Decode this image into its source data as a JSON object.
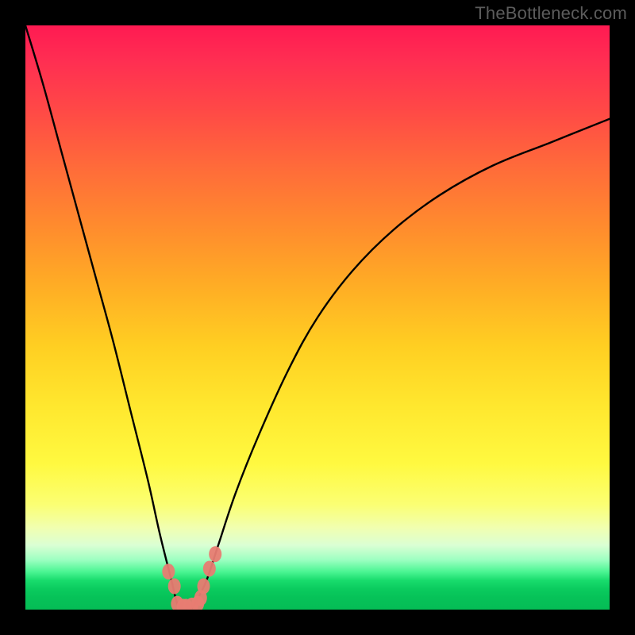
{
  "watermark": "TheBottleneck.com",
  "colors": {
    "frame": "#000000",
    "curve": "#000000",
    "marker": "#e87c72"
  },
  "chart_data": {
    "type": "line",
    "title": "",
    "xlabel": "",
    "ylabel": "",
    "xlim": [
      0,
      100
    ],
    "ylim": [
      0,
      100
    ],
    "grid": false,
    "x_optimum": 27,
    "note": "V-shaped bottleneck curve; value descends sharply to ~0 near x≈27 then rises again. Marker cluster at the trough.",
    "series": [
      {
        "name": "bottleneck-curve",
        "x": [
          0,
          3,
          6,
          9,
          12,
          15,
          18,
          21,
          23,
          25,
          26,
          27,
          28,
          29,
          31,
          33,
          36,
          40,
          45,
          50,
          56,
          63,
          71,
          80,
          90,
          100
        ],
        "values": [
          100,
          90,
          79,
          68,
          57,
          46,
          34,
          22,
          13,
          5,
          1,
          0,
          0,
          1,
          5,
          11,
          20,
          30,
          41,
          50,
          58,
          65,
          71,
          76,
          80,
          84
        ]
      }
    ],
    "markers": {
      "name": "optimum-points",
      "x": [
        24.5,
        25.5,
        26.0,
        27.0,
        27.5,
        28.5,
        29.5,
        30.0,
        30.5,
        31.5,
        32.5
      ],
      "values": [
        6.5,
        4.0,
        1.0,
        0.5,
        0.5,
        0.7,
        1.0,
        2.0,
        4.0,
        7.0,
        9.5
      ]
    }
  }
}
